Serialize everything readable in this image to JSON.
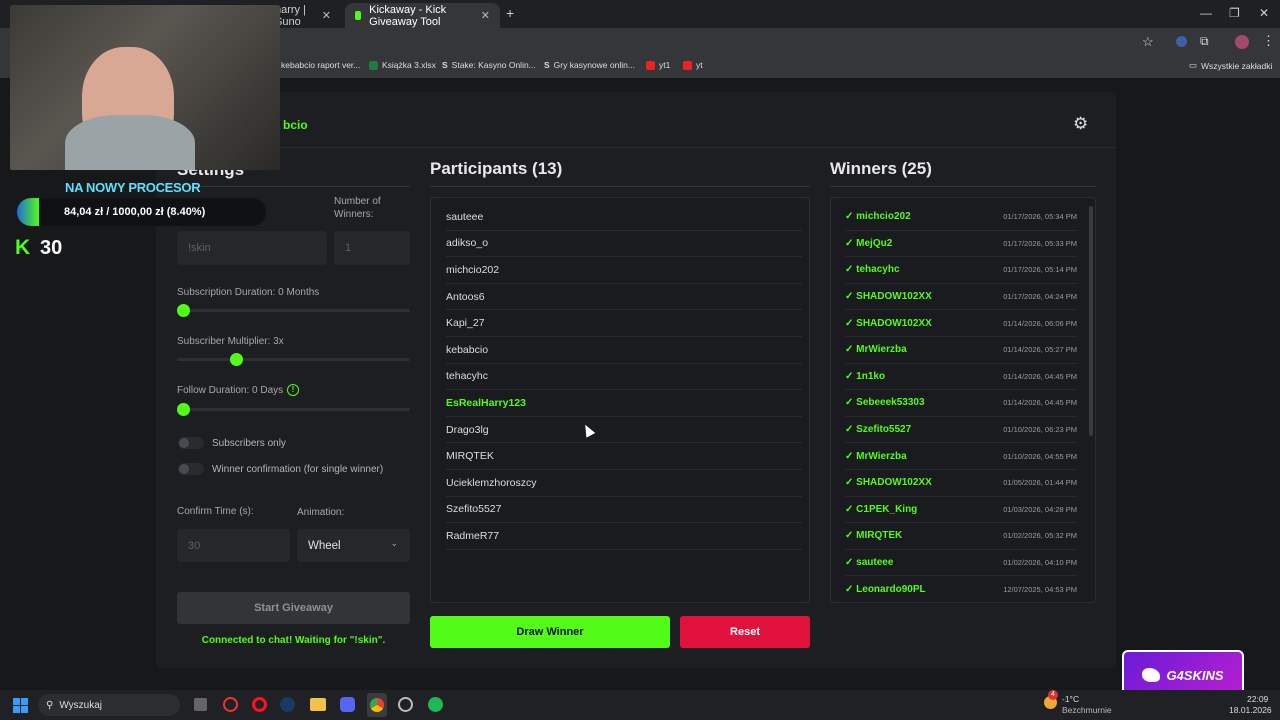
{
  "browser": {
    "tabs": [
      {
        "label": "harry | Suno",
        "active": false
      },
      {
        "label": "Kickaway - Kick Giveaway Tool",
        "active": true
      }
    ],
    "new_tab": "+",
    "bookmarks": [
      "kebabcio raport ver...",
      "Książka 3.xlsx",
      "Stake: Kasyno Onlin...",
      "Gry kasynowe onlin...",
      "yt1",
      "yt"
    ],
    "all_bookmarks": "Wszystkie zakładki"
  },
  "app": {
    "header_title": "bcio",
    "settings_title": "Settings",
    "keyword_placeholder": "!skin",
    "winners_label": "Number of Winners:",
    "winners_placeholder": "1",
    "sub_duration_label": "Subscription Duration: 0 Months",
    "sub_multiplier_label": "Subscriber Multiplier: 3x",
    "follow_label": "Follow Duration: 0 Days",
    "subscribers_only": "Subscribers only",
    "winner_confirmation": "Winner confirmation (for single winner)",
    "confirm_time_label": "Confirm Time (s):",
    "confirm_time_placeholder": "30",
    "animation_label": "Animation:",
    "animation_value": "Wheel",
    "start_button": "Start Giveaway",
    "status": "Connected to chat! Waiting for \"!skin\".",
    "sub_duration_level": 0,
    "sub_multiplier_level": 0.24,
    "follow_level": 0
  },
  "participants": {
    "title": "Participants (13)",
    "items": [
      {
        "name": "sauteee",
        "highlight": false
      },
      {
        "name": "adikso_o",
        "highlight": false
      },
      {
        "name": "michcio202",
        "highlight": false
      },
      {
        "name": "Antoos6",
        "highlight": false
      },
      {
        "name": "Kapi_27",
        "highlight": false
      },
      {
        "name": "kebabcio",
        "highlight": false
      },
      {
        "name": "tehacyhc",
        "highlight": false
      },
      {
        "name": "EsRealHarry123",
        "highlight": true
      },
      {
        "name": "Drago3lg",
        "highlight": false
      },
      {
        "name": "MIRQTEK",
        "highlight": false
      },
      {
        "name": "Ucieklemzhoroszcy",
        "highlight": false
      },
      {
        "name": "Szefito5527",
        "highlight": false
      },
      {
        "name": "RadmeR77",
        "highlight": false
      }
    ]
  },
  "winners": {
    "title": "Winners (25)",
    "items": [
      {
        "name": "✓ michcio202",
        "date": "01/17/2026, 05:34 PM"
      },
      {
        "name": "✓ MejQu2",
        "date": "01/17/2026, 05:33 PM"
      },
      {
        "name": "✓ tehacyhc",
        "date": "01/17/2026, 05:14 PM"
      },
      {
        "name": "✓ SHADOW102XX",
        "date": "01/17/2026, 04:24 PM"
      },
      {
        "name": "✓ SHADOW102XX",
        "date": "01/14/2026, 06:06 PM"
      },
      {
        "name": "✓ MrWierzba",
        "date": "01/14/2026, 05:27 PM"
      },
      {
        "name": "✓ 1n1ko",
        "date": "01/14/2026, 04:45 PM"
      },
      {
        "name": "✓ Sebeeek53303",
        "date": "01/14/2026, 04:45 PM"
      },
      {
        "name": "✓ Szefito5527",
        "date": "01/10/2026, 06:23 PM"
      },
      {
        "name": "✓ MrWierzba",
        "date": "01/10/2026, 04:55 PM"
      },
      {
        "name": "✓ SHADOW102XX",
        "date": "01/05/2026, 01:44 PM"
      },
      {
        "name": "✓ C1PEK_King",
        "date": "01/03/2026, 04:28 PM"
      },
      {
        "name": "✓ MIRQTEK",
        "date": "01/02/2026, 05:32 PM"
      },
      {
        "name": "✓ sauteee",
        "date": "01/02/2026, 04:10 PM"
      },
      {
        "name": "✓ Leonardo90PL",
        "date": "12/07/2025, 04:53 PM"
      }
    ]
  },
  "actions": {
    "draw": "Draw Winner",
    "reset": "Reset"
  },
  "overlay": {
    "goal_title": "NA NOWY PROCESOR",
    "goal_progress": "84,04 zł  /  1000,00 zł (8.40%)",
    "goal_fraction": 0.084,
    "kick_count": "30",
    "kick_logo": "K",
    "sponsor": "G4SKINS"
  },
  "taskbar": {
    "search": "Wyszukaj",
    "weather_temp": "-1°C",
    "weather_desc": "Bezchmurnie",
    "time": "22:09",
    "date": "18.01.2026",
    "badge": "4"
  },
  "colors": {
    "accent": "#53fc18",
    "reset": "#e0113c",
    "bg": "#1d1e21"
  }
}
